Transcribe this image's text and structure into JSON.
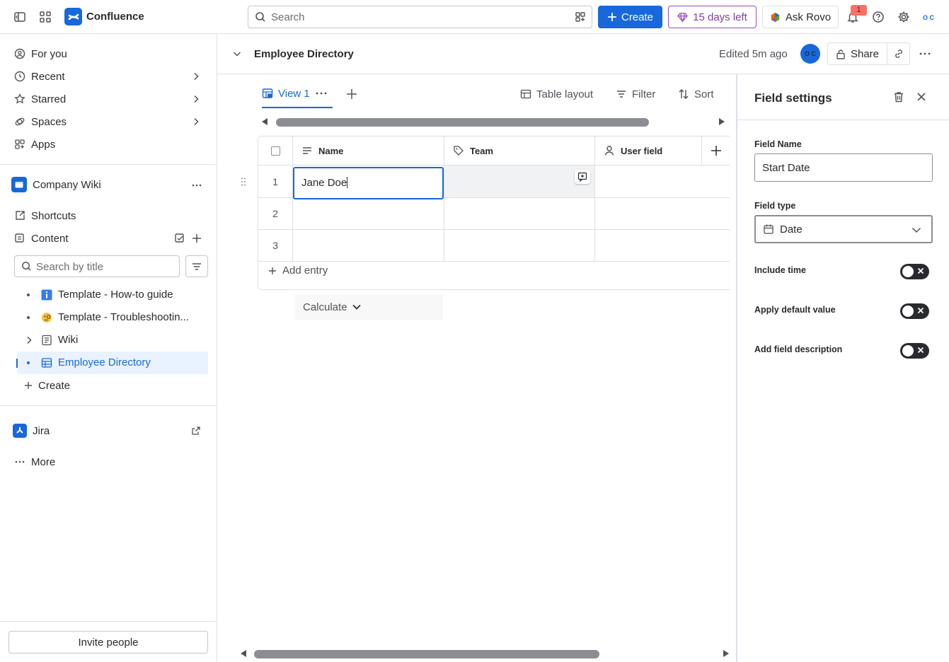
{
  "topbar": {
    "app_name": "Confluence",
    "search_placeholder": "Search",
    "create_label": "Create",
    "trial_label": "15 days left",
    "rovo_label": "Ask Rovo",
    "notification_count": "1",
    "avatar_initials": "O C"
  },
  "sidebar": {
    "nav": [
      {
        "label": "For you",
        "icon": "user-circle-icon"
      },
      {
        "label": "Recent",
        "icon": "clock-icon"
      },
      {
        "label": "Starred",
        "icon": "star-icon"
      },
      {
        "label": "Spaces",
        "icon": "spaces-icon"
      },
      {
        "label": "Apps",
        "icon": "apps-icon"
      }
    ],
    "space_name": "Company Wiki",
    "shortcuts_label": "Shortcuts",
    "content_label": "Content",
    "search_placeholder": "Search by title",
    "tree": [
      {
        "label": "Template - How-to guide",
        "icon": "info-icon"
      },
      {
        "label": "Template - Troubleshootin...",
        "icon": "emoji-icon"
      },
      {
        "label": "Wiki",
        "icon": "page-icon"
      },
      {
        "label": "Employee Directory",
        "icon": "database-icon",
        "active": true
      }
    ],
    "create_label": "Create",
    "jira_label": "Jira",
    "more_label": "More",
    "invite_label": "Invite people"
  },
  "page": {
    "title": "Employee Directory",
    "edited": "Edited 5m ago",
    "avatar_initials": "O C",
    "share_label": "Share"
  },
  "database": {
    "view_label": "View 1",
    "toolbar": {
      "layout": "Table layout",
      "filter": "Filter",
      "sort": "Sort"
    },
    "columns": [
      {
        "label": "Name",
        "icon": "text-lines-icon"
      },
      {
        "label": "Team",
        "icon": "tag-icon"
      },
      {
        "label": "User field",
        "icon": "person-icon"
      }
    ],
    "rows": [
      {
        "num": "1",
        "name": "Jane Doe",
        "team": "",
        "user": ""
      },
      {
        "num": "2",
        "name": "",
        "team": "",
        "user": ""
      },
      {
        "num": "3",
        "name": "",
        "team": "",
        "user": ""
      }
    ],
    "add_entry_label": "Add entry",
    "calculate_label": "Calculate"
  },
  "field_settings": {
    "title": "Field settings",
    "name_label": "Field Name",
    "name_value": "Start Date",
    "type_label": "Field type",
    "type_value": "Date",
    "toggles": [
      {
        "label": "Include time",
        "on": false
      },
      {
        "label": "Apply default value",
        "on": false
      },
      {
        "label": "Add field description",
        "on": false
      }
    ]
  },
  "colors": {
    "accent": "#1868db",
    "trial": "#803fa5",
    "badge": "#f87168",
    "selected_bg": "#e9f2fe"
  }
}
